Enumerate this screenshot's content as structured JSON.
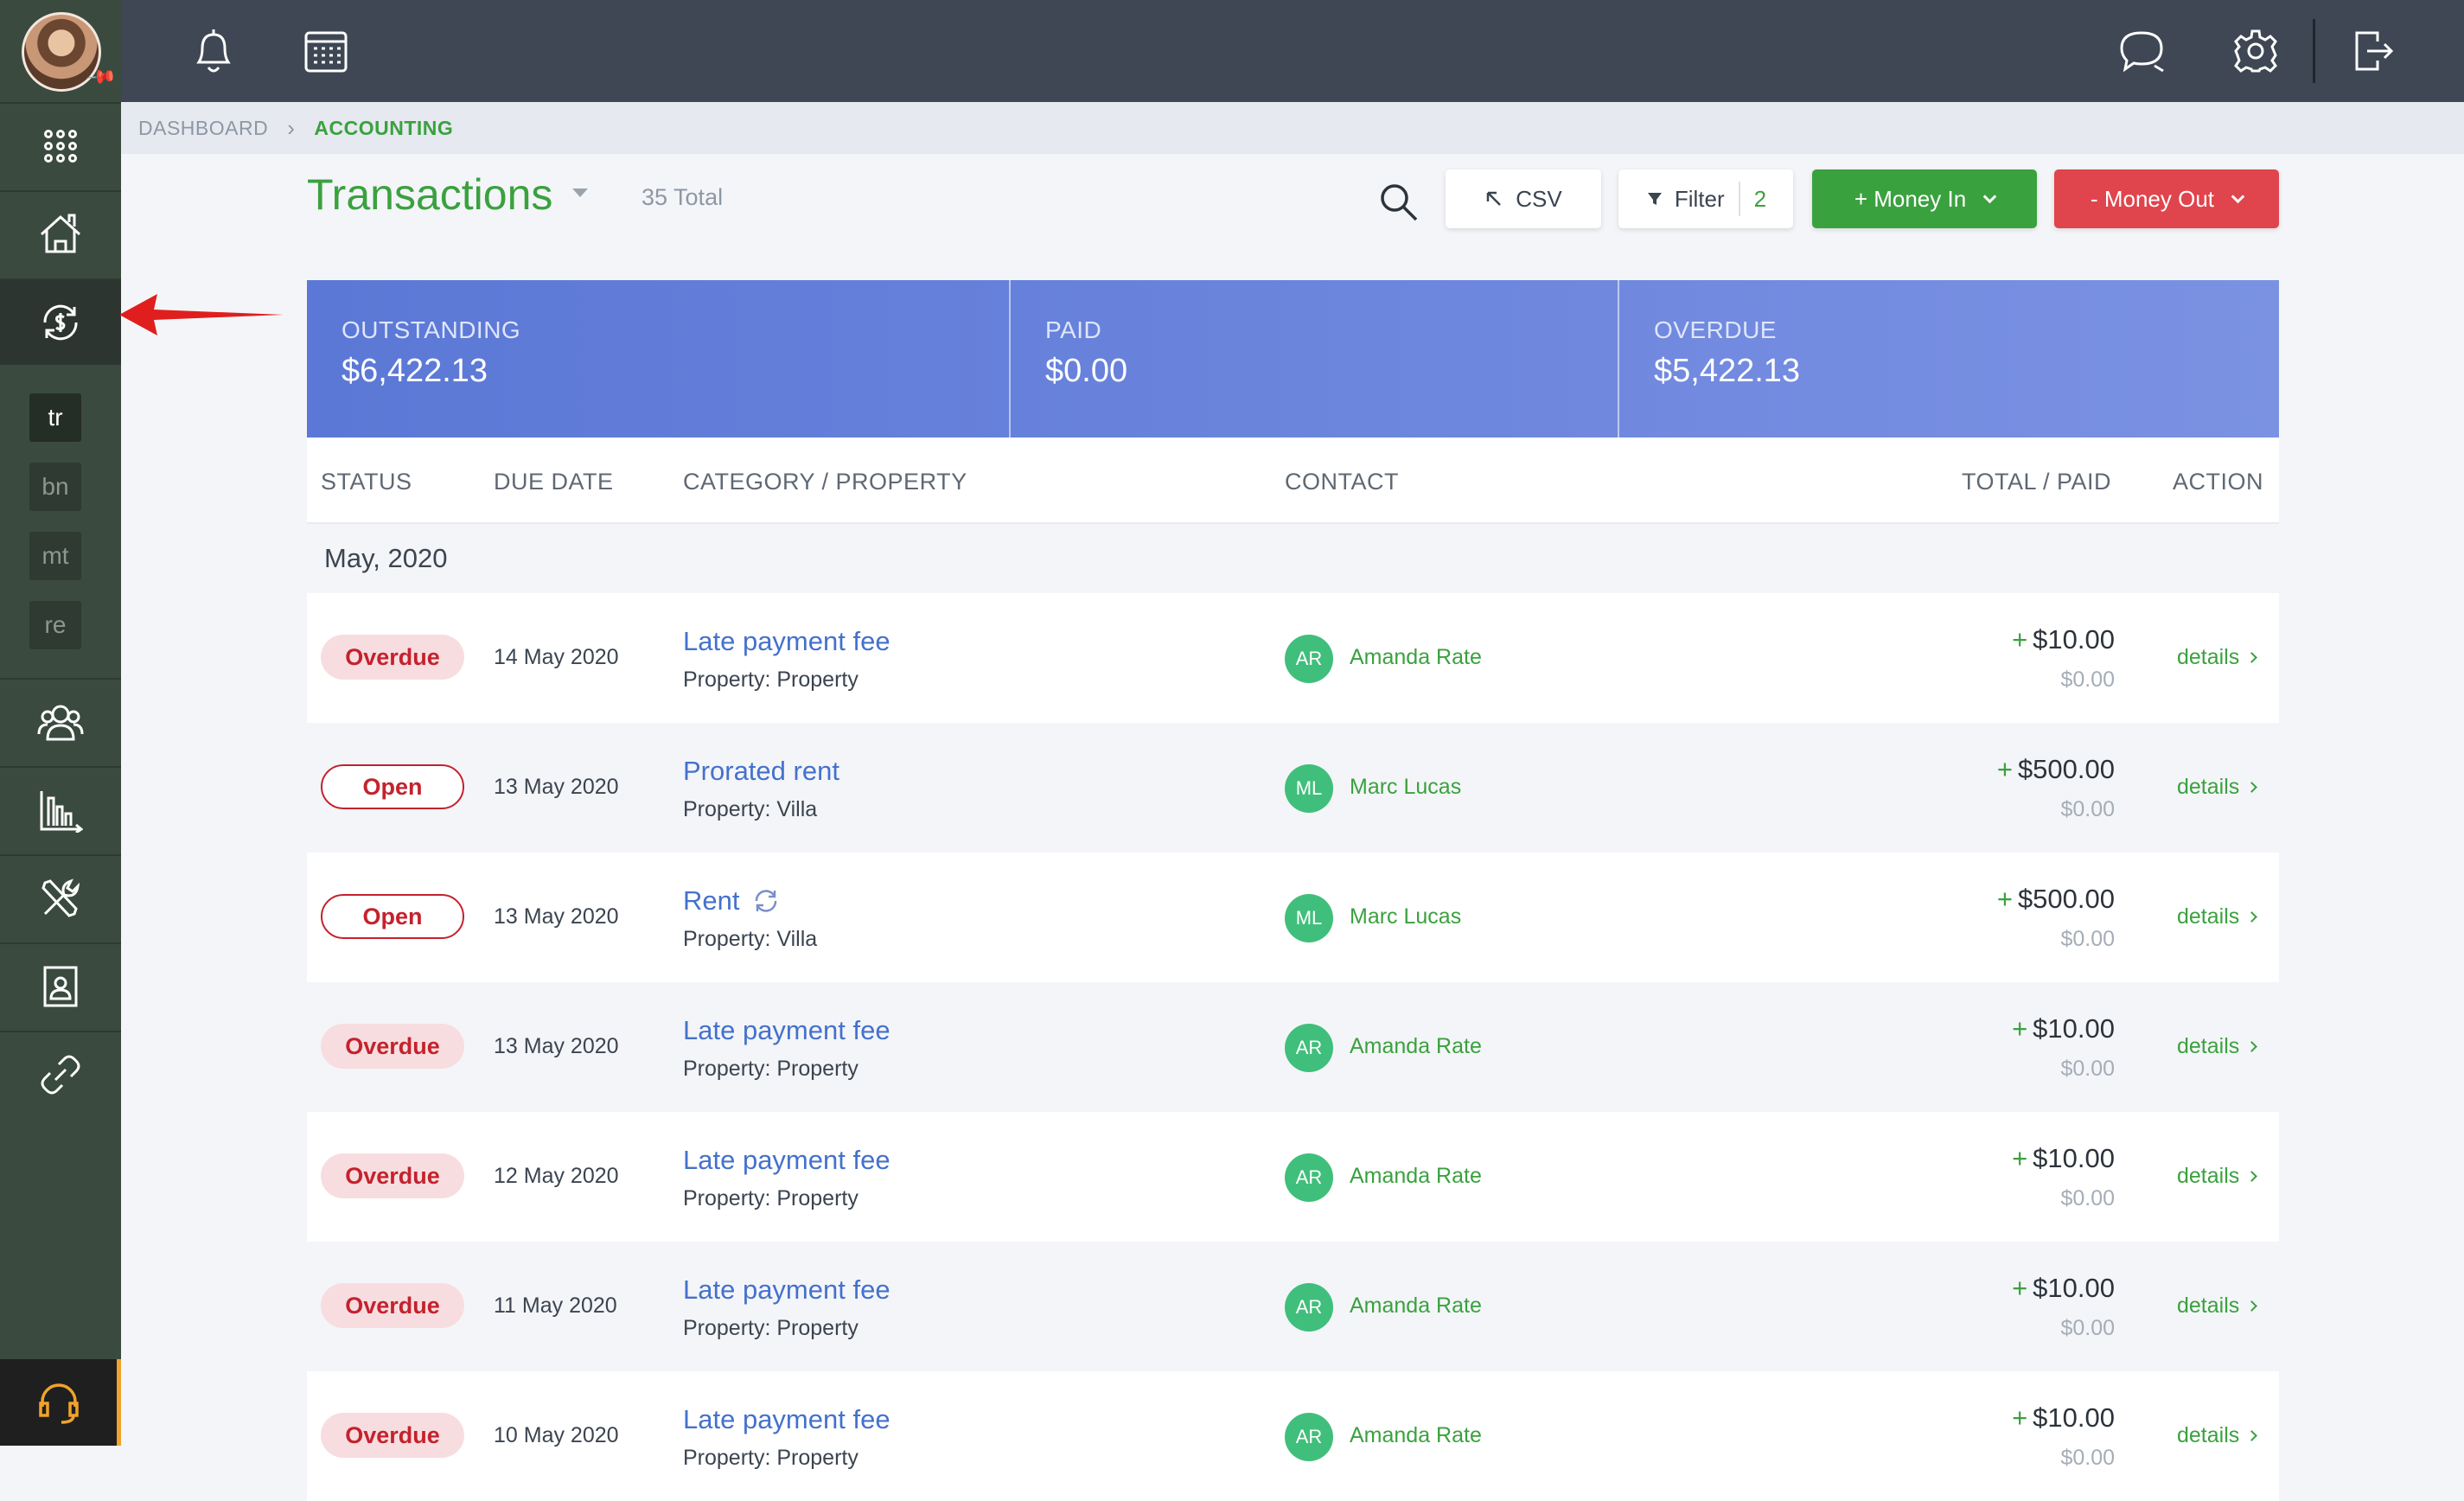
{
  "breadcrumb": {
    "dashboard": "DASHBOARD",
    "accounting": "ACCOUNTING"
  },
  "header": {
    "title": "Transactions",
    "total": "35 Total",
    "csv_label": "CSV",
    "filter_label": "Filter",
    "filter_count": "2",
    "money_in_label": "+ Money In",
    "money_out_label": "- Money Out"
  },
  "sidebar": {
    "sub_items": [
      "tr",
      "bn",
      "mt",
      "re"
    ],
    "icons": [
      "apps-grid-icon",
      "house-icon",
      "money-cycle-icon",
      "people-icon",
      "bar-chart-icon",
      "tools-icon",
      "contact-document-icon",
      "link-icon",
      "headset-icon"
    ]
  },
  "topbar": {
    "icons": [
      "bell-icon",
      "calendar-icon",
      "chat-icon",
      "gear-icon",
      "logout-icon"
    ]
  },
  "summary": {
    "outstanding_label": "OUTSTANDING",
    "outstanding_value": "$6,422.13",
    "paid_label": "PAID",
    "paid_value": "$0.00",
    "overdue_label": "OVERDUE",
    "overdue_value": "$5,422.13"
  },
  "table": {
    "columns": [
      "STATUS",
      "DUE DATE",
      "CATEGORY / PROPERTY",
      "CONTACT",
      "TOTAL / PAID",
      "ACTION"
    ],
    "group": "May, 2020",
    "rows": [
      {
        "status": "Overdue",
        "due": "14 May 2020",
        "category": "Late payment fee",
        "property": "Property: Property",
        "initials": "AR",
        "contact": "Amanda Rate",
        "total": "$10.00",
        "paid": "$0.00",
        "action": "details",
        "recurring": false
      },
      {
        "status": "Open",
        "due": "13 May 2020",
        "category": "Prorated rent",
        "property": "Property: Villa",
        "initials": "ML",
        "contact": "Marc Lucas",
        "total": "$500.00",
        "paid": "$0.00",
        "action": "details",
        "recurring": false
      },
      {
        "status": "Open",
        "due": "13 May 2020",
        "category": "Rent",
        "property": "Property: Villa",
        "initials": "ML",
        "contact": "Marc Lucas",
        "total": "$500.00",
        "paid": "$0.00",
        "action": "details",
        "recurring": true
      },
      {
        "status": "Overdue",
        "due": "13 May 2020",
        "category": "Late payment fee",
        "property": "Property: Property",
        "initials": "AR",
        "contact": "Amanda Rate",
        "total": "$10.00",
        "paid": "$0.00",
        "action": "details",
        "recurring": false
      },
      {
        "status": "Overdue",
        "due": "12 May 2020",
        "category": "Late payment fee",
        "property": "Property: Property",
        "initials": "AR",
        "contact": "Amanda Rate",
        "total": "$10.00",
        "paid": "$0.00",
        "action": "details",
        "recurring": false
      },
      {
        "status": "Overdue",
        "due": "11 May 2020",
        "category": "Late payment fee",
        "property": "Property: Property",
        "initials": "AR",
        "contact": "Amanda Rate",
        "total": "$10.00",
        "paid": "$0.00",
        "action": "details",
        "recurring": false
      },
      {
        "status": "Overdue",
        "due": "10 May 2020",
        "category": "Late payment fee",
        "property": "Property: Property",
        "initials": "AR",
        "contact": "Amanda Rate",
        "total": "$10.00",
        "paid": "$0.00",
        "action": "details",
        "recurring": false
      }
    ]
  },
  "colors": {
    "accent_green": "#3aa13f",
    "danger_red": "#e0444c",
    "summary_blue": "#5b78d6",
    "link_blue": "#4471cc",
    "sidebar": "#3a4a3f",
    "topbar": "#3e4753"
  }
}
